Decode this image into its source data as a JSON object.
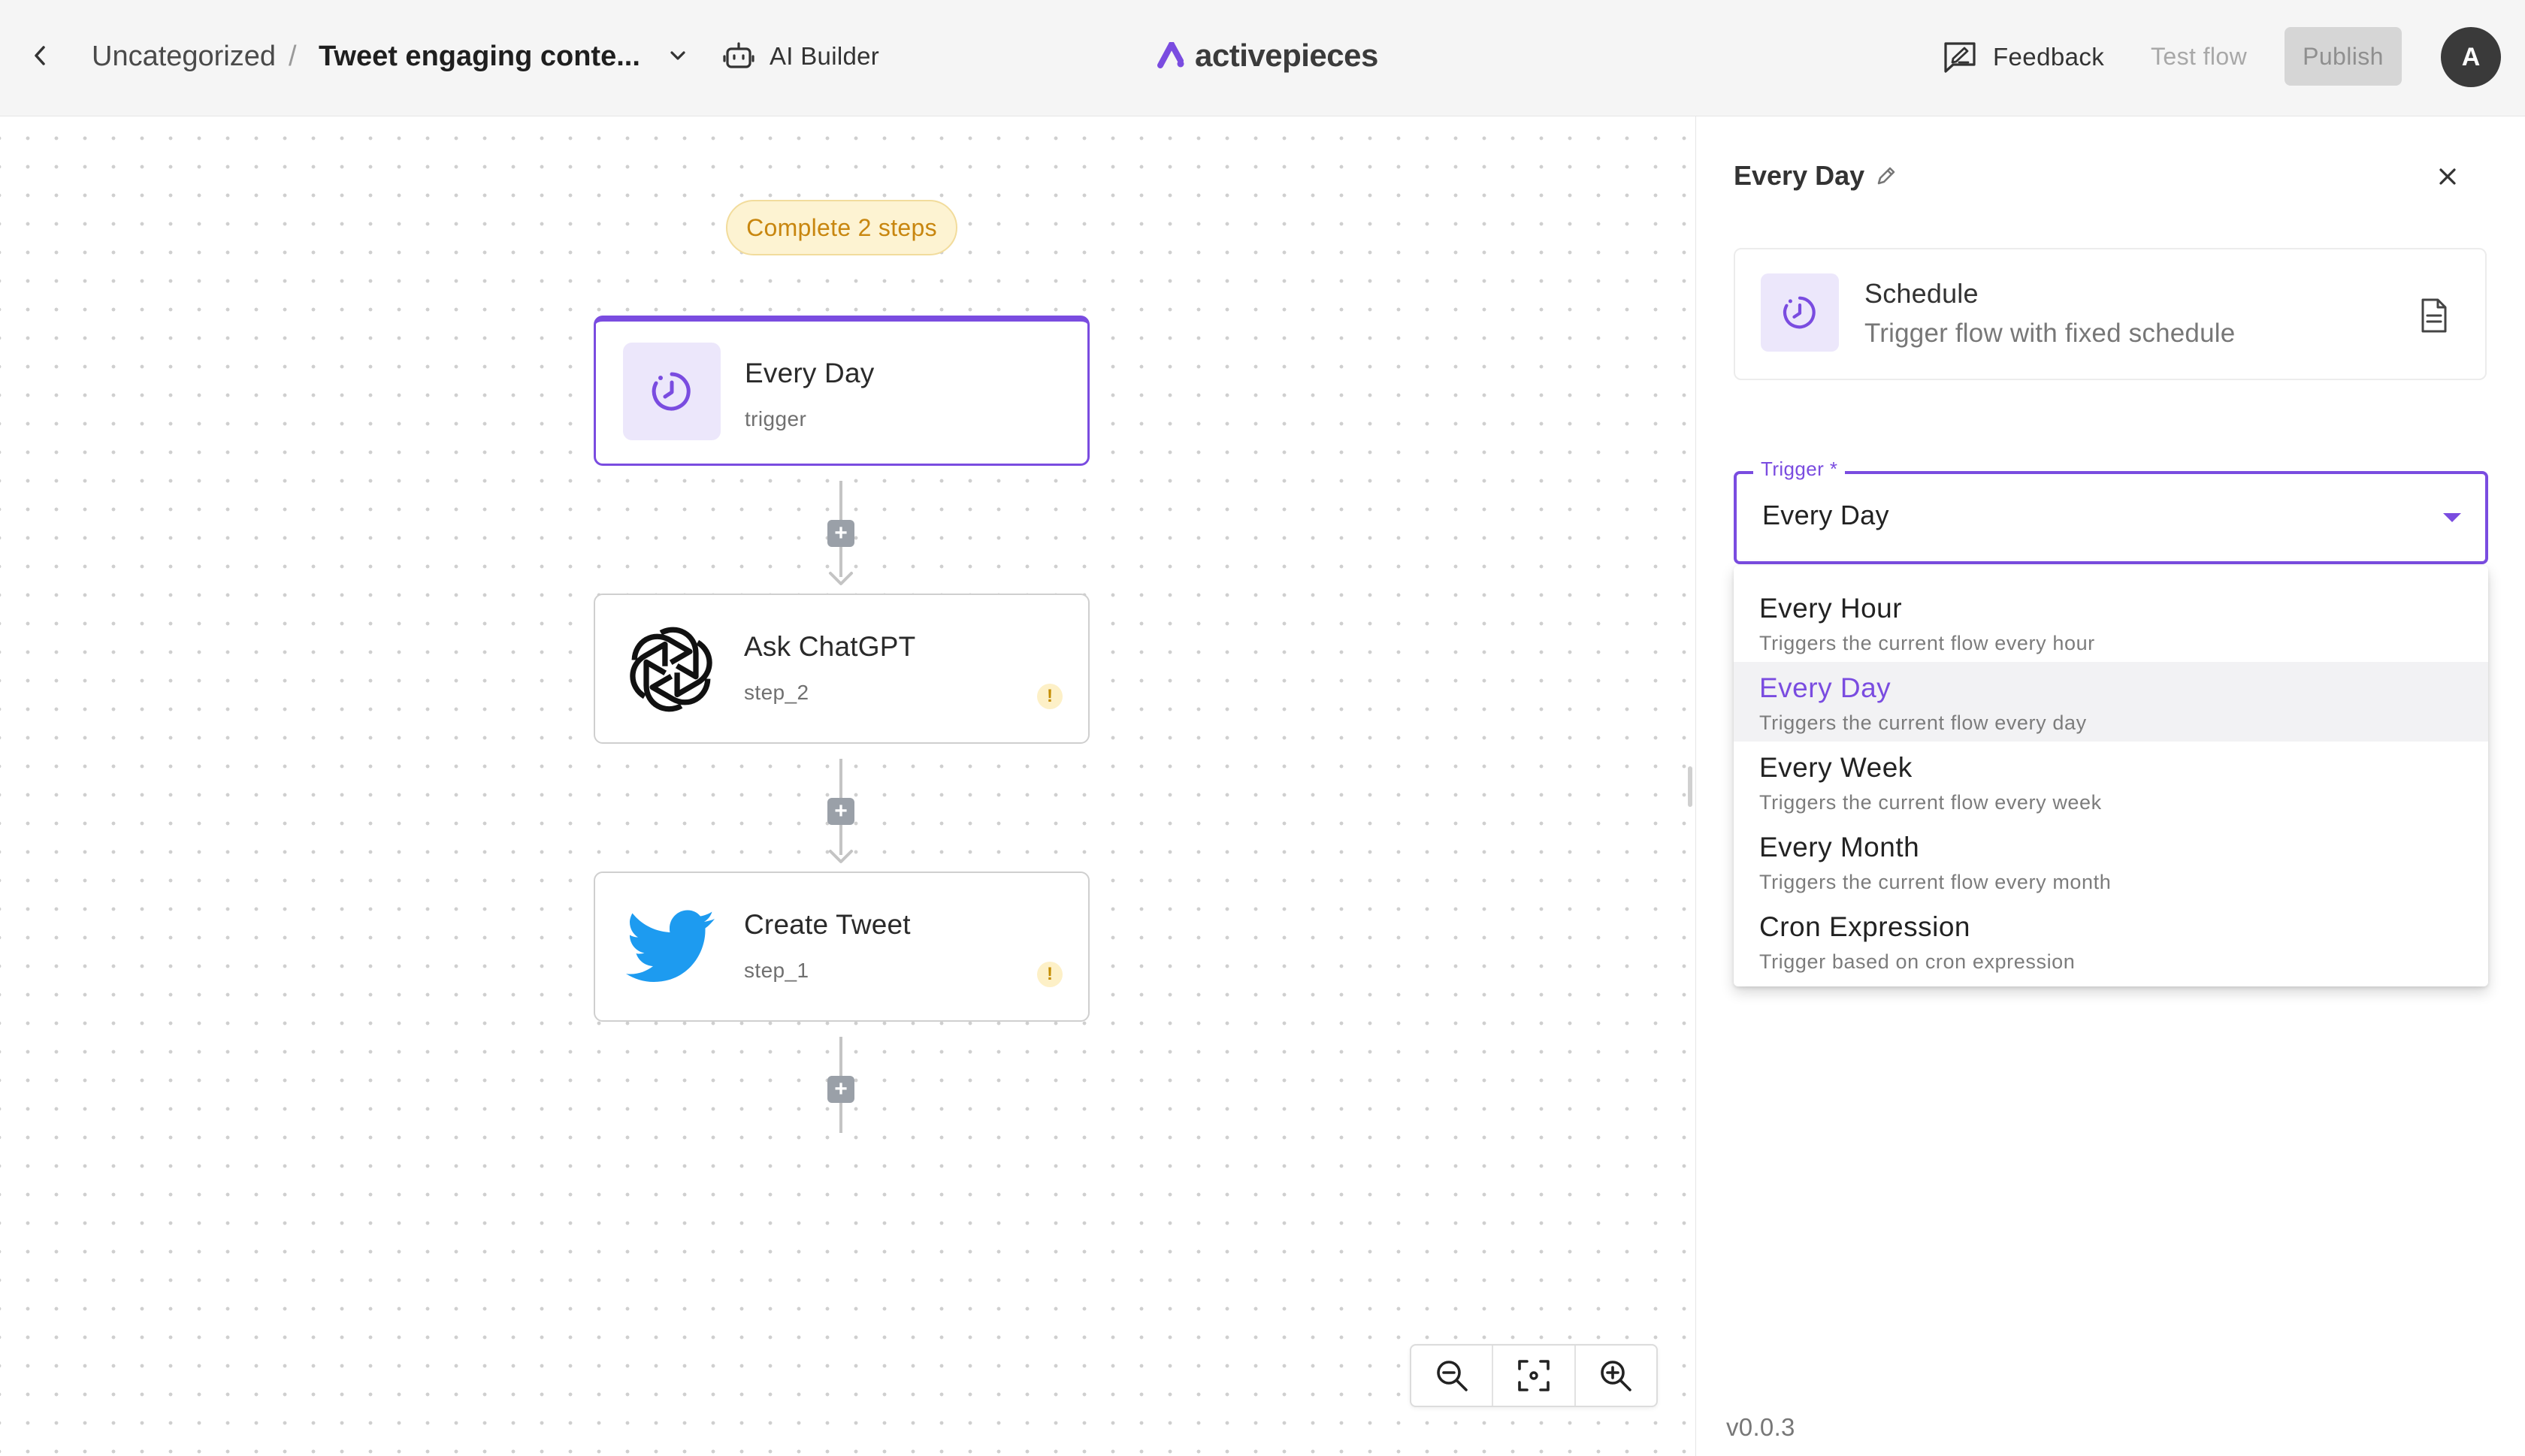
{
  "header": {
    "breadcrumb_folder": "Uncategorized",
    "breadcrumb_separator": "/",
    "flow_name": "Tweet engaging conte...",
    "ai_builder_label": "AI Builder",
    "brand_name": "activepieces",
    "feedback_label": "Feedback",
    "test_flow_label": "Test flow",
    "publish_label": "Publish",
    "avatar_initial": "A"
  },
  "canvas": {
    "badge_text": "Complete 2 steps",
    "steps": [
      {
        "title": "Every Day",
        "subtitle": "trigger",
        "icon": "schedule-icon",
        "warning": ""
      },
      {
        "title": "Ask ChatGPT",
        "subtitle": "step_2",
        "icon": "openai-icon",
        "warning": "!"
      },
      {
        "title": "Create Tweet",
        "subtitle": "step_1",
        "icon": "twitter-icon",
        "warning": "!"
      }
    ],
    "add_step_symbol": "+"
  },
  "panel": {
    "title": "Every Day",
    "piece": {
      "name": "Schedule",
      "description": "Trigger flow with fixed schedule"
    },
    "trigger_field": {
      "label": "Trigger *",
      "value": "Every Day"
    },
    "options": [
      {
        "label": "Every Hour",
        "description": "Triggers the current flow every hour"
      },
      {
        "label": "Every Day",
        "description": "Triggers the current flow every day"
      },
      {
        "label": "Every Week",
        "description": "Triggers the current flow every week"
      },
      {
        "label": "Every Month",
        "description": "Triggers the current flow every month"
      },
      {
        "label": "Cron Expression",
        "description": "Trigger based on cron expression"
      }
    ],
    "active_option": "Every Day",
    "version": "v0.0.3"
  },
  "colors": {
    "accent": "#7a4ce0",
    "warning": "#c48c00",
    "twitter": "#1d9bf0"
  }
}
